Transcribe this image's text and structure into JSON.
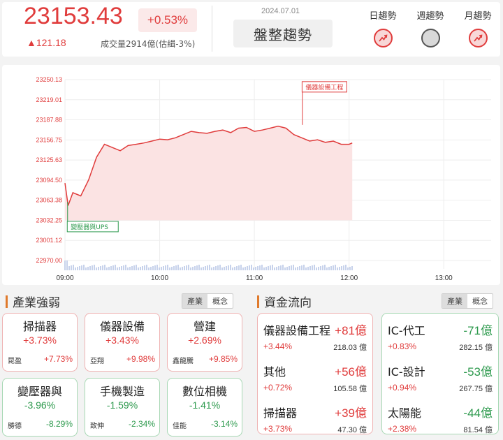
{
  "header": {
    "index_value": "23153.43",
    "change_pct": "+0.53%",
    "change_pts": "▲121.18",
    "volume": "成交量2914億(估緝-3%)",
    "date": "2024.07.01",
    "trend_label": "盤整趨勢",
    "trends": [
      {
        "label": "日趨勢",
        "state": "up"
      },
      {
        "label": "週趨勢",
        "state": "flat"
      },
      {
        "label": "月趨勢",
        "state": "up"
      }
    ]
  },
  "chart_data": {
    "type": "area",
    "y_tick_labels": [
      "23250.13",
      "23219.01",
      "23187.88",
      "23156.75",
      "23125.63",
      "23094.50",
      "23063.38",
      "23032.25",
      "23001.12",
      "22970.00"
    ],
    "ylim": [
      22970.0,
      23250.13
    ],
    "x_tick_labels": [
      "09:00",
      "10:00",
      "11:00",
      "12:00",
      "13:00"
    ],
    "xlim": [
      "09:00",
      "13:30"
    ],
    "reference_value": 23032.25,
    "series": [
      {
        "x": [
          "09:00",
          "09:02",
          "09:05",
          "09:10",
          "09:15",
          "09:20",
          "09:25",
          "09:30",
          "09:35",
          "09:40",
          "09:45",
          "09:50",
          "09:55",
          "10:00",
          "10:05",
          "10:10",
          "10:15",
          "10:20",
          "10:25",
          "10:30",
          "10:35",
          "10:40",
          "10:45",
          "10:50",
          "10:55",
          "11:00",
          "11:05",
          "11:10",
          "11:15",
          "11:20",
          "11:25",
          "11:30",
          "11:35",
          "11:40",
          "11:45",
          "11:50",
          "11:55",
          "12:00",
          "12:02"
        ],
        "values": [
          23090,
          23055,
          23075,
          23070,
          23095,
          23130,
          23150,
          23145,
          23140,
          23148,
          23150,
          23152,
          23155,
          23158,
          23157,
          23160,
          23165,
          23170,
          23168,
          23167,
          23170,
          23172,
          23168,
          23175,
          23176,
          23170,
          23172,
          23175,
          23178,
          23175,
          23165,
          23160,
          23155,
          23157,
          23153,
          23155,
          23150,
          23150,
          23152
        ]
      }
    ],
    "volume_series_present": true,
    "annotations": [
      {
        "label": "儀器設備工程",
        "x": "11:32",
        "y": 23180
      },
      {
        "label": "變壓器與UPS",
        "x": "09:01",
        "y": 23035
      }
    ],
    "colors": {
      "line": "#e03c3c",
      "fill": "#fbe3e3",
      "up": "#e03c3c",
      "down": "#2e9a4e"
    }
  },
  "industry": {
    "title": "產業強弱",
    "toggle": [
      "產業",
      "概念"
    ],
    "cards": [
      {
        "name": "掃描器",
        "pct": "+3.73%",
        "stock": "昆盈",
        "stock_pct": "+7.73%",
        "dir": "up"
      },
      {
        "name": "儀器設備",
        "pct": "+3.43%",
        "stock": "亞翔",
        "stock_pct": "+9.98%",
        "dir": "up"
      },
      {
        "name": "營建",
        "pct": "+2.69%",
        "stock": "鑫龍騰",
        "stock_pct": "+9.85%",
        "dir": "up"
      },
      {
        "name": "變壓器與",
        "pct": "-3.96%",
        "stock": "勝德",
        "stock_pct": "-8.29%",
        "dir": "down"
      },
      {
        "name": "手機製造",
        "pct": "-1.59%",
        "stock": "致伸",
        "stock_pct": "-2.34%",
        "dir": "down"
      },
      {
        "name": "數位相機",
        "pct": "-1.41%",
        "stock": "佳能",
        "stock_pct": "-3.14%",
        "dir": "down"
      }
    ]
  },
  "funds": {
    "title": "資金流向",
    "toggle": [
      "產業",
      "概念"
    ],
    "inflow": [
      {
        "name": "儀器設備工程",
        "amount": "+81億",
        "pct": "+3.44%",
        "value": "218.03 億"
      },
      {
        "name": "其他",
        "amount": "+56億",
        "pct": "+0.72%",
        "value": "105.58 億"
      },
      {
        "name": "掃描器",
        "amount": "+39億",
        "pct": "+3.73%",
        "value": "47.30 億"
      }
    ],
    "outflow": [
      {
        "name": "IC-代工",
        "amount": "-71億",
        "pct": "+0.83%",
        "value": "282.15 億"
      },
      {
        "name": "IC-設計",
        "amount": "-53億",
        "pct": "+0.94%",
        "value": "267.75 億"
      },
      {
        "name": "太陽能",
        "amount": "-44億",
        "pct": "+2.38%",
        "value": "81.54 億"
      }
    ]
  }
}
